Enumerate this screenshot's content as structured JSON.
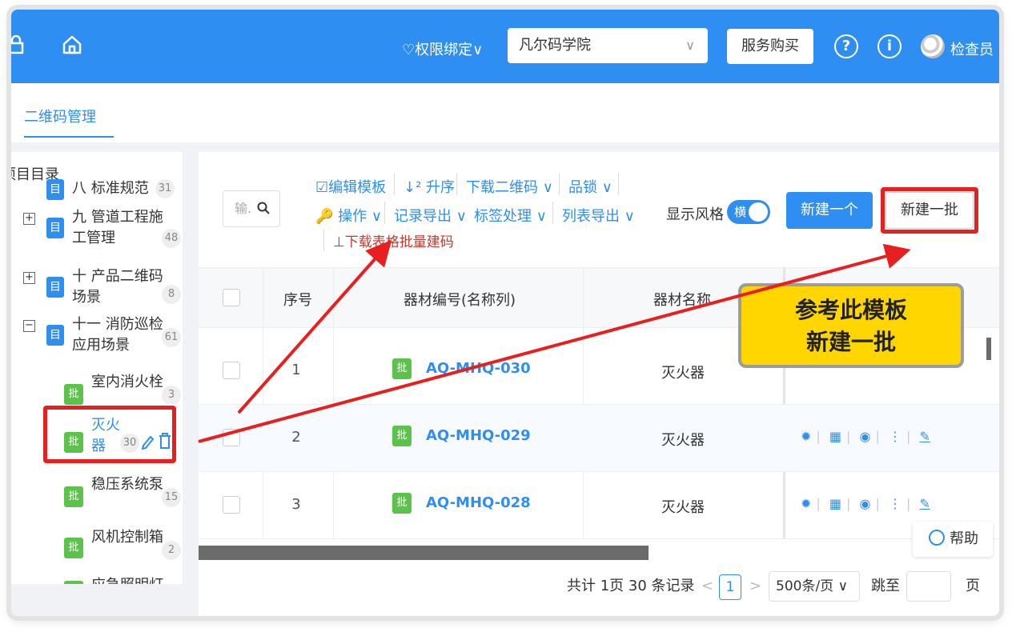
{
  "topbar": {
    "auth_binding": "♡权限绑定∨",
    "org_select": "凡尔码学院",
    "buy_service": "服务购买",
    "help_icon": "?",
    "info_icon": "i",
    "username": "检查员"
  },
  "tabs": {
    "qr_management": "二维码管理"
  },
  "sidebar": {
    "title": "项目目录",
    "nodes": [
      {
        "expander": "",
        "icon": "目",
        "label_l1": "八 标准规范",
        "label_l2": "",
        "count": "31"
      },
      {
        "expander": "+",
        "icon": "目",
        "label_l1": "九 管道工程施",
        "label_l2": "工管理",
        "count": "48"
      },
      {
        "expander": "+",
        "icon": "目",
        "label_l1": "十 产品二维码",
        "label_l2": "场景",
        "count": "8"
      },
      {
        "expander": "−",
        "icon": "目",
        "label_l1": "十一 消防巡检",
        "label_l2": "应用场景",
        "count": "61"
      },
      {
        "icon": "批",
        "label_l1": "室内消火栓",
        "label_l2": "",
        "count": "3"
      },
      {
        "icon": "批",
        "label_l1": "灭火",
        "label_l2": "器",
        "count": "30"
      },
      {
        "icon": "批",
        "label_l1": "稳压系统泵",
        "label_l2": "",
        "count": "15"
      },
      {
        "icon": "批",
        "label_l1": "风机控制箱",
        "label_l2": "",
        "count": "2"
      },
      {
        "icon": "批",
        "label_l1": "应急照明灯",
        "label_l2": "",
        "count": ""
      }
    ]
  },
  "toolbar": {
    "search_placeholder": "输.",
    "edit_template": "☑编辑模板",
    "sort_asc": "↓² 升序",
    "download_qr": "下载二维码 ∨",
    "lock": "品锁 ∨",
    "operate": "🔑 操作 ∨",
    "record_export": "记录导出 ∨",
    "label_process": "标签处理 ∨",
    "list_export": "列表导出 ∨",
    "download_template": "⊥下载表格批量建码",
    "display_style": "显示风格",
    "style_toggle": "横",
    "new_one": "新建一个",
    "new_batch": "新建一批"
  },
  "table": {
    "headers": {
      "seq": "序号",
      "code": "器材编号(名称列)",
      "name": "器材名称"
    },
    "rows": [
      {
        "seq": "1",
        "badge": "批",
        "code": "AQ-MHQ-030",
        "name": "灭火器"
      },
      {
        "seq": "2",
        "badge": "批",
        "code": "AQ-MHQ-029",
        "name": "灭火器"
      },
      {
        "seq": "3",
        "badge": "批",
        "code": "AQ-MHQ-028",
        "name": "灭火器"
      }
    ]
  },
  "help": "帮助",
  "pager": {
    "summary": "共计 1页 30 条记录",
    "prev": "<",
    "current": "1",
    "next": ">",
    "page_size": "500条/页 ∨",
    "jump_to": "跳至",
    "page_unit": "页"
  },
  "callout": {
    "line1": "参考此模板",
    "line2": "新建一批"
  },
  "colors": {
    "primary": "#2f8ef2",
    "highlight": "#e81f1f",
    "callout": "#ffd600",
    "batch_green": "#5cc34a"
  }
}
